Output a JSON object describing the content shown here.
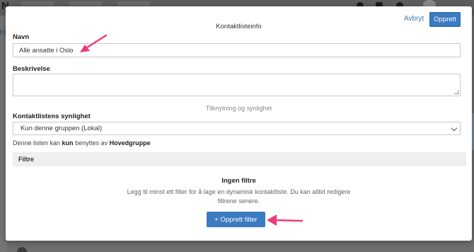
{
  "background": {
    "logo": "N",
    "left_hint": "H"
  },
  "modal": {
    "title": "Kontaktlisteinfo",
    "cancel_label": "Avbryt",
    "create_label": "Opprett",
    "name": {
      "label": "Navn",
      "value": "Alle ansatte i Oslo"
    },
    "description": {
      "label": "Beskrivelse",
      "value": ""
    },
    "section_caption": "Tilknytning og synlighet",
    "visibility": {
      "label": "Kontaktlistens synlighet",
      "selected": "Kun denne gruppen (Lokal)",
      "helper_prefix": "Denne listen kan ",
      "helper_bold1": "kun",
      "helper_middle": " benyttes av ",
      "helper_bold2": "Hovedgruppe"
    },
    "filters": {
      "header": "Filtre",
      "empty_title": "Ingen filtre",
      "empty_description": "Legg til minst ett filter for å lage en dynamisk kontaktliste. Du kan alltid redigere filtrene senere.",
      "create_filter_label": "+ Opprett filter"
    }
  },
  "colors": {
    "accent": "#3b7bbf",
    "annotation_arrow": "#ec3a7c",
    "overlay": "#6f6f6f"
  }
}
